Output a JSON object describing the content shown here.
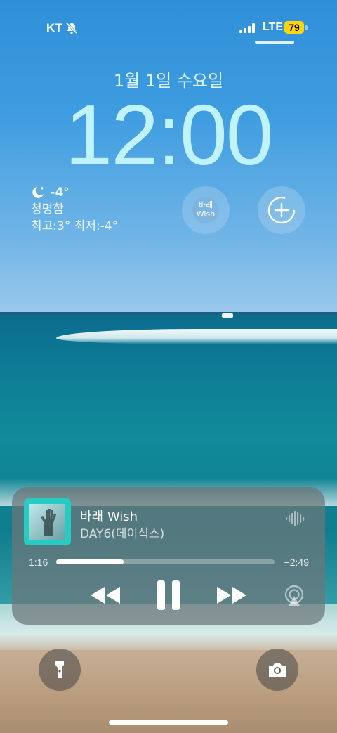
{
  "status_bar": {
    "carrier": "KT",
    "network": "LTE",
    "battery": "79",
    "icons": [
      "bell-slash-icon",
      "signal-bars-icon",
      "battery-icon"
    ]
  },
  "lock_screen": {
    "date": "1월 1일 수요일",
    "time": "12:00"
  },
  "weather": {
    "icon": "moon-stars-icon",
    "temperature": "-4°",
    "condition": "청명함",
    "high_low": "최고:3° 최저:-4°"
  },
  "widgets": {
    "song_widget": "바래 Wish",
    "add_widget_icon": "plus-circle-icon"
  },
  "now_playing": {
    "title": "바래 Wish",
    "artist": "DAY6(데이식스)",
    "elapsed": "1:16",
    "remaining": "−2:49",
    "progress": 0.31,
    "controls": [
      "rewind-icon",
      "pause-icon",
      "fast-forward-icon",
      "airplay-icon"
    ],
    "art_color": "#26cbc4"
  },
  "quick_actions": {
    "left": "flashlight-icon",
    "right": "camera-icon"
  }
}
